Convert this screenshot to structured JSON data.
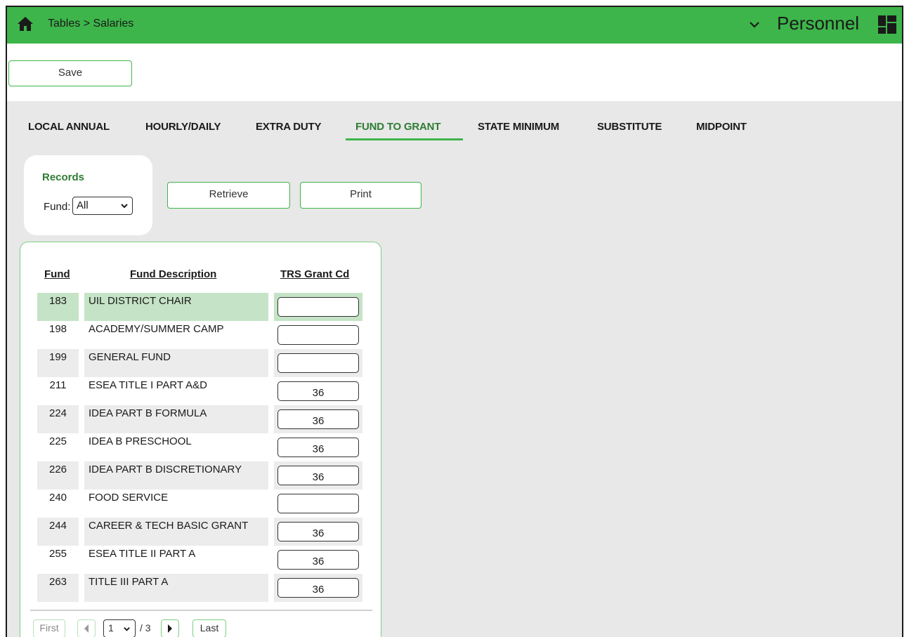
{
  "header": {
    "breadcrumb": "Tables > Salaries",
    "app_name": "Personnel"
  },
  "toolbar": {
    "save_label": "Save"
  },
  "tabs": [
    {
      "label": "LOCAL ANNUAL",
      "active": false
    },
    {
      "label": "HOURLY/DAILY",
      "active": false
    },
    {
      "label": "EXTRA DUTY",
      "active": false
    },
    {
      "label": "FUND TO GRANT",
      "active": true
    },
    {
      "label": "STATE MINIMUM",
      "active": false
    },
    {
      "label": "SUBSTITUTE",
      "active": false
    },
    {
      "label": "MIDPOINT",
      "active": false
    }
  ],
  "records": {
    "title": "Records",
    "fund_label": "Fund:",
    "fund_value": "All",
    "retrieve_label": "Retrieve",
    "print_label": "Print"
  },
  "table": {
    "columns": [
      "Fund",
      "Fund Description",
      "TRS Grant Cd"
    ],
    "rows": [
      {
        "fund": "183",
        "description": "UIL DISTRICT CHAIR",
        "grant": ""
      },
      {
        "fund": "198",
        "description": "ACADEMY/SUMMER CAMP",
        "grant": ""
      },
      {
        "fund": "199",
        "description": "GENERAL FUND",
        "grant": ""
      },
      {
        "fund": "211",
        "description": "ESEA TITLE I PART A&D",
        "grant": "36"
      },
      {
        "fund": "224",
        "description": "IDEA PART B FORMULA",
        "grant": "36"
      },
      {
        "fund": "225",
        "description": "IDEA B PRESCHOOL",
        "grant": "36"
      },
      {
        "fund": "226",
        "description": "IDEA PART B DISCRETIONARY",
        "grant": "36"
      },
      {
        "fund": "240",
        "description": "FOOD SERVICE",
        "grant": ""
      },
      {
        "fund": "244",
        "description": "CAREER & TECH BASIC GRANT",
        "grant": "36"
      },
      {
        "fund": "255",
        "description": "ESEA TITLE II PART A",
        "grant": "36"
      },
      {
        "fund": "263",
        "description": "TITLE III PART A",
        "grant": "36"
      }
    ]
  },
  "pagination": {
    "first_label": "First",
    "last_label": "Last",
    "current_page": "1",
    "of_text": "/ 3"
  },
  "colors": {
    "brand_green": "#3db54a",
    "selected_row": "#c5e3c6",
    "shaded_row": "#ececec"
  },
  "icons": [
    "home-icon",
    "chevron-down-icon",
    "grid-icon",
    "chevron-left-icon",
    "chevron-right-icon"
  ]
}
